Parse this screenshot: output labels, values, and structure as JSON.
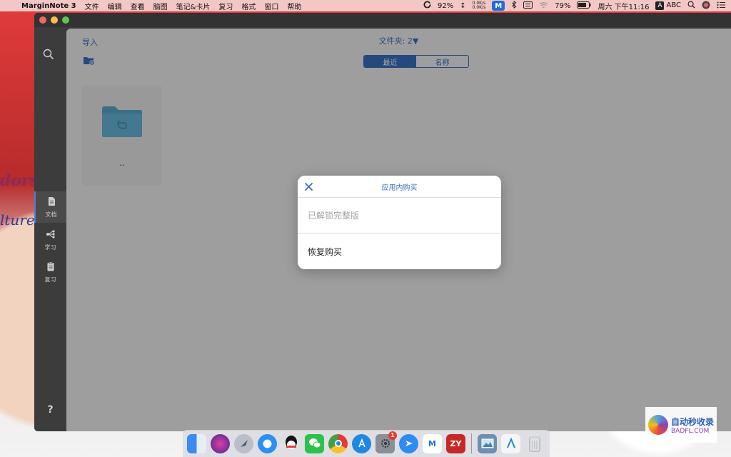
{
  "menubar": {
    "apple": "",
    "app_name": "MarginNote 3",
    "menus": [
      "文件",
      "编辑",
      "查看",
      "脑图",
      "笔记&卡片",
      "复习",
      "格式",
      "窗口",
      "帮助"
    ],
    "cpu_percent": "92%",
    "net_up": "0.0K/s",
    "net_down": "0.0K/s",
    "mn_badge": "M",
    "battery": "79%",
    "datetime": "周六 下午11:16",
    "input_source": "ABC",
    "input_letter": "A"
  },
  "sidebar": {
    "items": [
      {
        "label": "文档"
      },
      {
        "label": "学习"
      },
      {
        "label": "复习"
      }
    ],
    "help": "?",
    "more": "···"
  },
  "main": {
    "import_label": "导入",
    "folder_title": "文件夹: 2▼",
    "segments": [
      {
        "label": "最近",
        "active": true
      },
      {
        "label": "名称",
        "active": false
      }
    ],
    "folder_name": ".."
  },
  "modal": {
    "title": "应用内购买",
    "rows": [
      {
        "label": "已解锁完整版",
        "enabled": false
      },
      {
        "label": "恢复购买",
        "enabled": true
      }
    ]
  },
  "dock": {
    "app_store_badge": "1",
    "zy_label": "ZY",
    "mn_label": "M"
  },
  "watermark": {
    "cn": "自动秒收录",
    "en": "BADFL.COM"
  },
  "wallpaper": {
    "text1": "dors",
    "text2": "lture"
  },
  "colors": {
    "accent": "#3b6fc2",
    "modal_bg": "#ffffff",
    "sidebar_bg": "#3c3c3c",
    "menubar_bg": "#f2c7c5"
  }
}
